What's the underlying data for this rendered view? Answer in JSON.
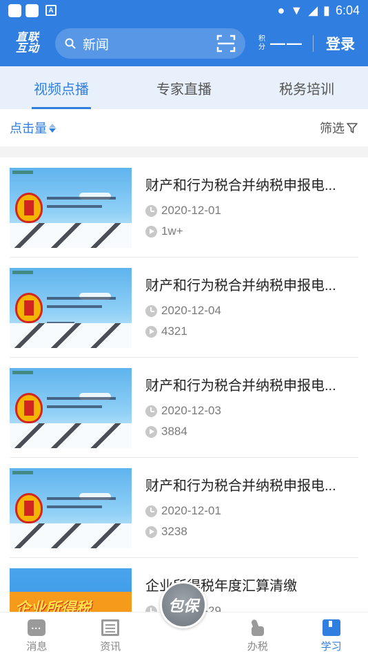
{
  "status_bar": {
    "time": "6:04",
    "app_icon_letter": "A"
  },
  "header": {
    "logo_line1": "直联",
    "logo_line2": "互动",
    "search_value": "新闻",
    "points_label": "积分",
    "points_value": "——",
    "login_label": "登录"
  },
  "tabs": [
    {
      "label": "视频点播",
      "active": true
    },
    {
      "label": "专家直播",
      "active": false
    },
    {
      "label": "税务培训",
      "active": false
    }
  ],
  "filter": {
    "sort_label": "点击量",
    "filter_label": "筛选"
  },
  "videos": [
    {
      "title": "财产和行为税合并纳税申报电...",
      "date": "2020-12-01",
      "views": "1w+"
    },
    {
      "title": "财产和行为税合并纳税申报电...",
      "date": "2020-12-04",
      "views": "4321"
    },
    {
      "title": "财产和行为税合并纳税申报电...",
      "date": "2020-12-03",
      "views": "3884"
    },
    {
      "title": "财产和行为税合并纳税申报电...",
      "date": "2020-12-01",
      "views": "3238"
    },
    {
      "title": "企业所得税年度汇算清缴",
      "date": "2020-12-29",
      "views": "",
      "thumb_text": "企业所得税"
    }
  ],
  "bottom_nav": [
    {
      "label": "消息",
      "icon": "message-icon"
    },
    {
      "label": "资讯",
      "icon": "news-icon"
    },
    {
      "label": "办税",
      "icon": "tax-icon"
    },
    {
      "label": "学习",
      "icon": "learn-icon",
      "active": true
    }
  ],
  "center_button": "包保",
  "colors": {
    "primary": "#2f7ee0",
    "tab_bg": "#e8f1fb",
    "meta_gray": "#7a7a7a"
  }
}
